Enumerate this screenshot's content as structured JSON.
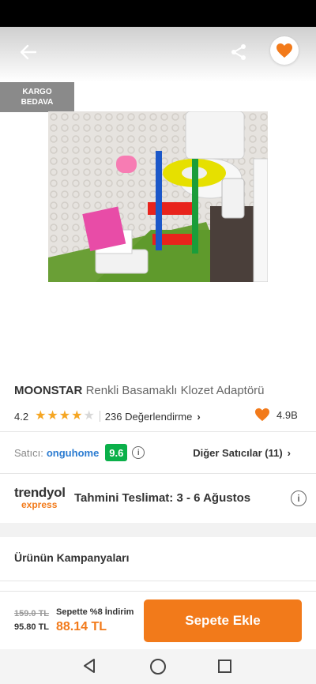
{
  "badge": {
    "line1": "KARGO",
    "line2": "BEDAVA"
  },
  "icons": {
    "back": "back-arrow-icon",
    "share": "share-icon",
    "favorite": "heart-icon"
  },
  "product": {
    "brand": "MOONSTAR",
    "name": "Renkli Basamaklı Klozet Adaptörü",
    "rating": "4.2",
    "rating_value": 4.2,
    "stars_filled": 4,
    "stars_total": 5,
    "reviews": "236 Değerlendirme",
    "favorites": "4.9B"
  },
  "seller": {
    "label": "Satıcı:",
    "name": "onguhome",
    "score": "9.6",
    "other_sellers": "Diğer Satıcılar (11)"
  },
  "delivery": {
    "logo_top": "trendyol",
    "logo_bottom": "express",
    "label": "Tahmini Teslimat:",
    "dates": "3 - 6 Ağustos"
  },
  "campaign": {
    "title": "Ürünün Kampanyaları"
  },
  "price": {
    "original": "159.0 TL",
    "previous": "95.80 TL",
    "discount_label": "Sepette %8 İndirim",
    "final": "88.14 TL"
  },
  "cart": {
    "button": "Sepete Ekle"
  },
  "colors": {
    "accent": "#f27a1a",
    "seller_score": "#0bb04a",
    "seller_link": "#2a7bd1",
    "star": "#f5a623"
  }
}
